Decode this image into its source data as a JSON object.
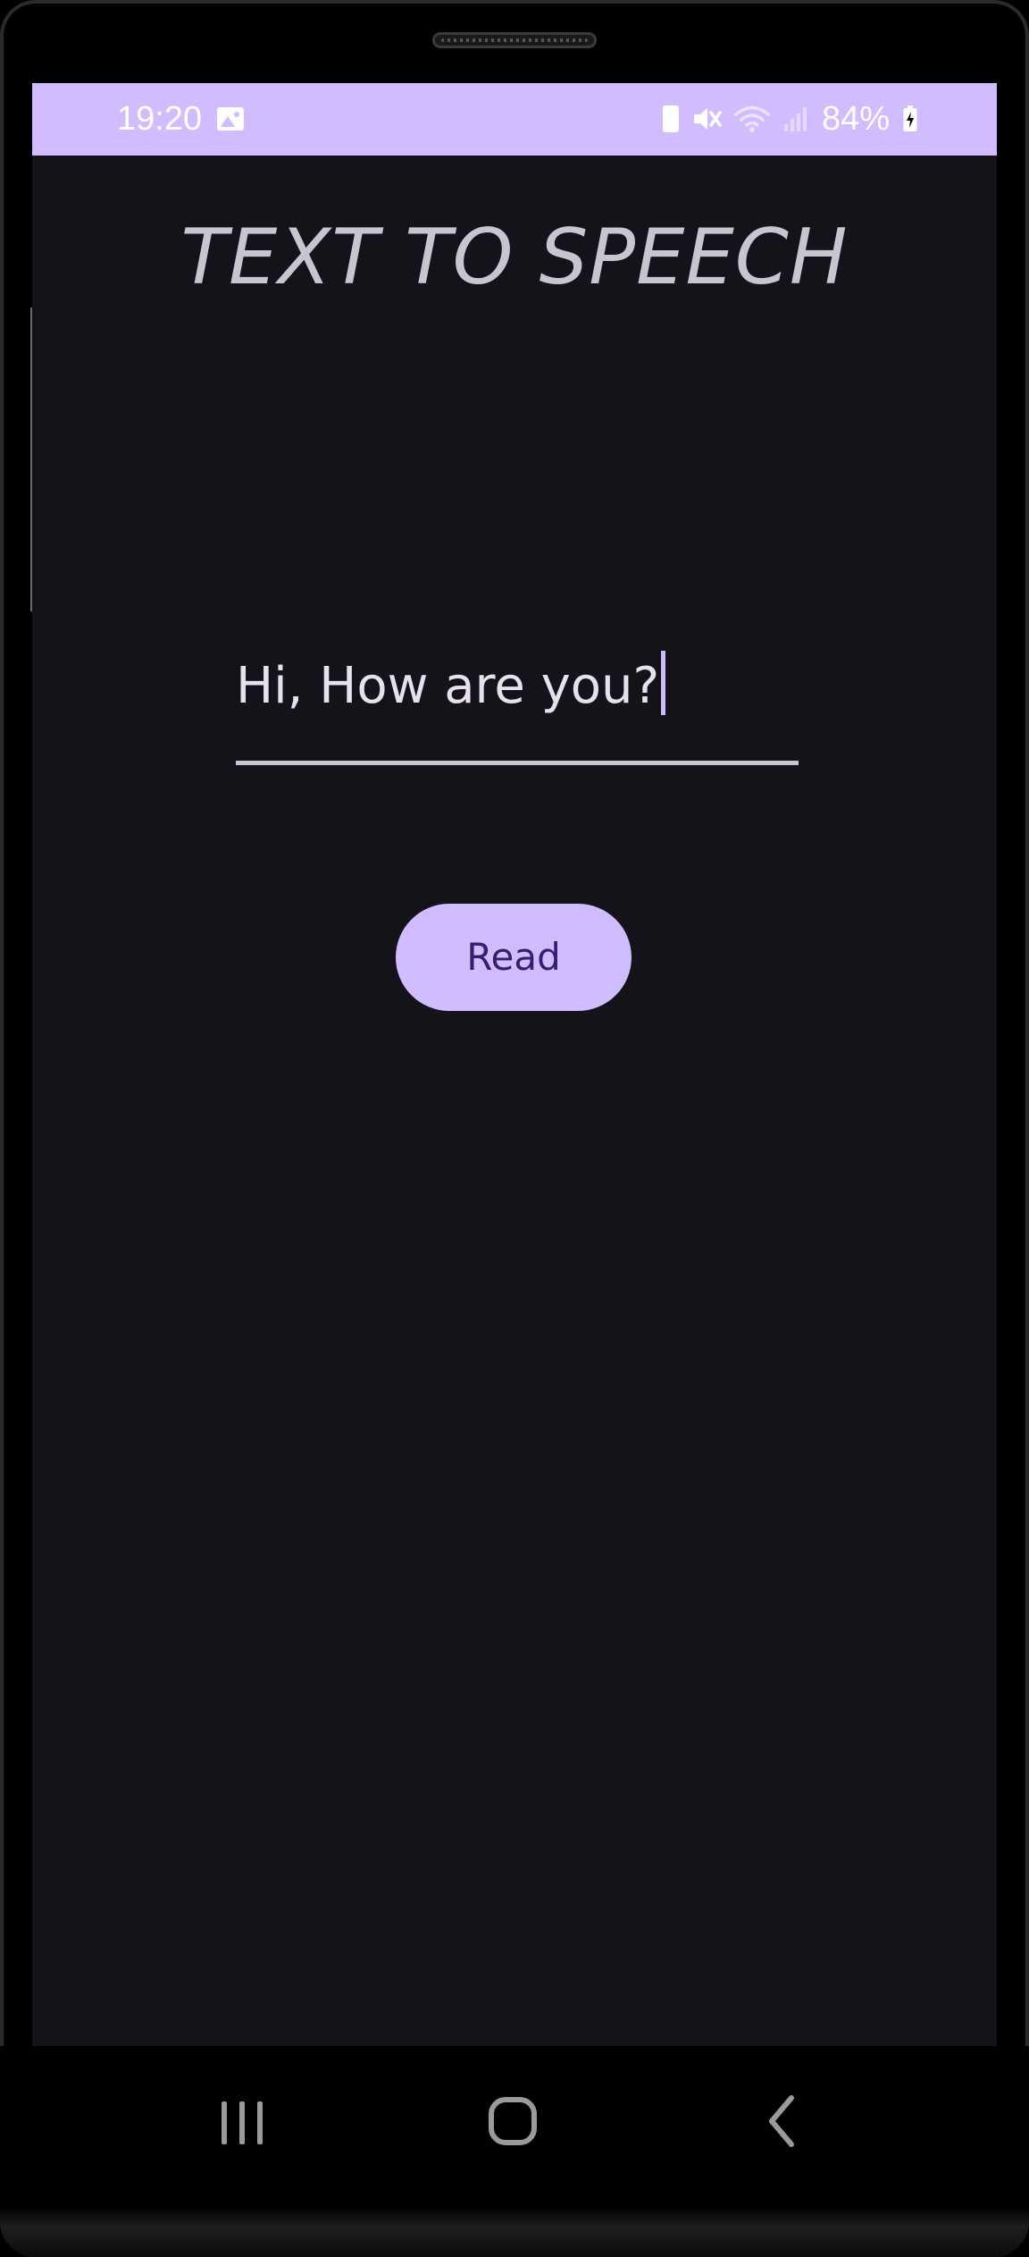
{
  "status_bar": {
    "time": "19:20",
    "battery_percent": "84%",
    "icons": [
      "gallery-icon",
      "battery-saver-icon",
      "mute-icon",
      "wifi-icon",
      "signal-icon",
      "charging-icon"
    ],
    "background_color": "#d0bcfe"
  },
  "app": {
    "title": "TEXT TO SPEECH",
    "input_value": "Hi, How are you?",
    "read_button_label": "Read",
    "accent_color": "#d0bcfe",
    "background_color": "#15131a"
  },
  "navigation": {
    "icons": [
      "recents-icon",
      "home-icon",
      "back-icon"
    ]
  }
}
